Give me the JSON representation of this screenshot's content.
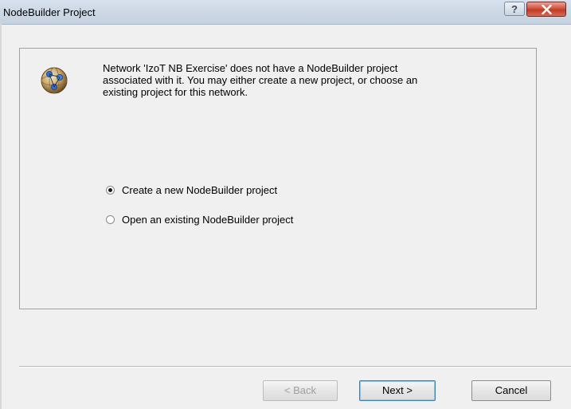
{
  "window": {
    "title": "NodeBuilder Project",
    "help_label": "?"
  },
  "message": {
    "lines": [
      "Network 'IzoT NB Exercise' does not have a NodeBuilder project",
      "associated with it. You may either create a new project, or choose an",
      "existing project for this network."
    ]
  },
  "options": [
    {
      "label": "Create a new NodeBuilder project",
      "selected": true
    },
    {
      "label": "Open an existing NodeBuilder project",
      "selected": false
    }
  ],
  "buttons": {
    "back": {
      "label": "< Back",
      "enabled": false
    },
    "next": {
      "label": "Next >",
      "enabled": true
    },
    "cancel": {
      "label": "Cancel",
      "enabled": true
    }
  },
  "colors": {
    "dialog_background": "#f0f0f0",
    "close_button": "#c9472f"
  },
  "icons": {
    "dialog_icon": "network-globe-icon",
    "close_icon": "close-icon"
  }
}
